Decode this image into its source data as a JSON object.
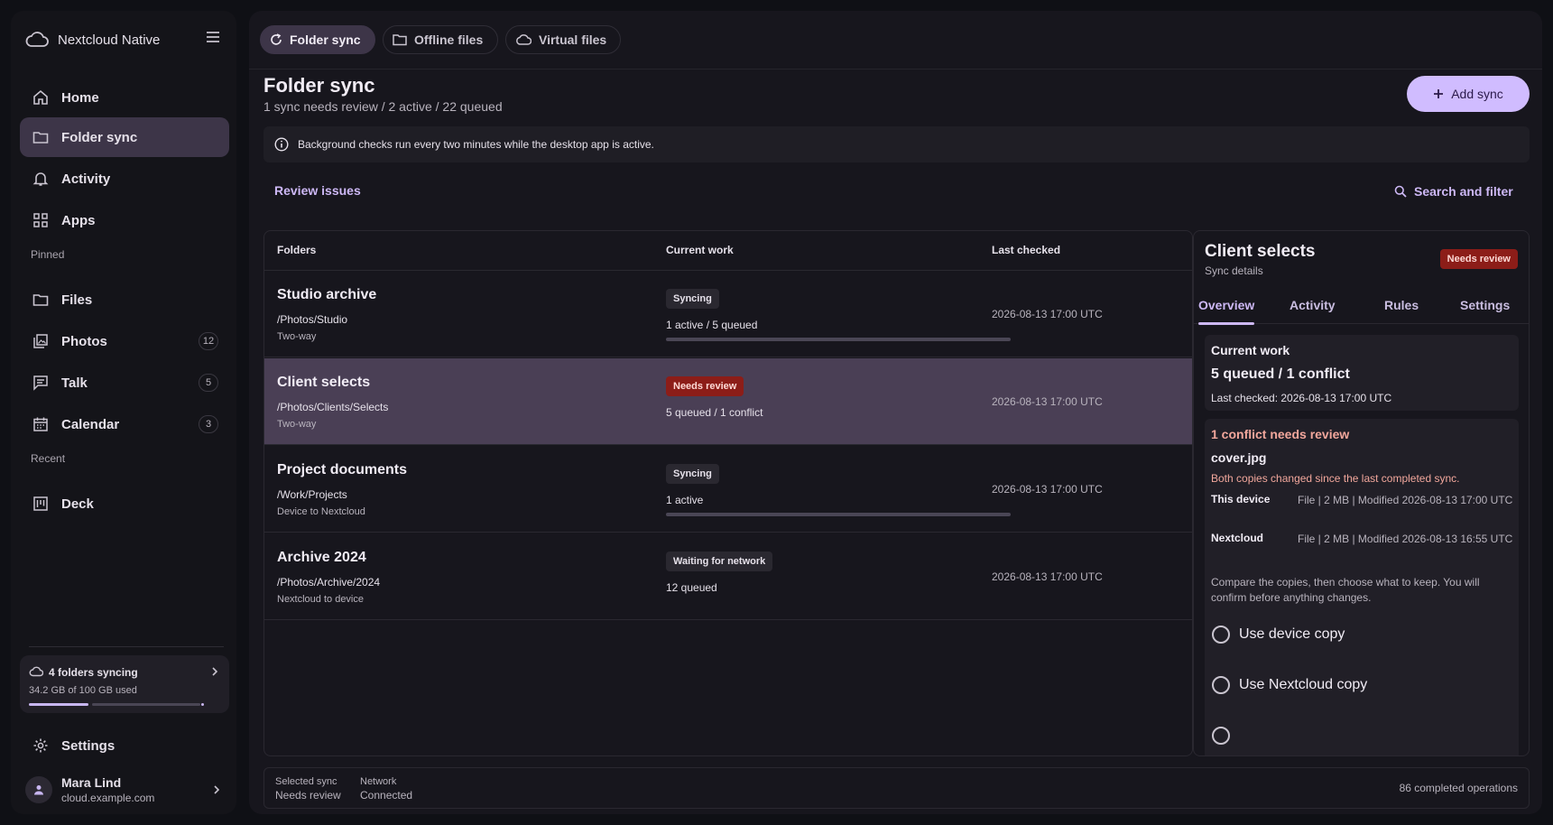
{
  "app": {
    "name": "Nextcloud Native"
  },
  "sidebar": {
    "nav": [
      {
        "label": "Home",
        "icon": "home-icon"
      },
      {
        "label": "Folder sync",
        "icon": "folder-icon",
        "active": true
      },
      {
        "label": "Activity",
        "icon": "bell-icon"
      },
      {
        "label": "Apps",
        "icon": "apps-grid-icon"
      }
    ],
    "pinned_label": "Pinned",
    "pinned": [
      {
        "label": "Files",
        "icon": "folder-icon",
        "count": ""
      },
      {
        "label": "Photos",
        "icon": "photos-icon",
        "count": "12"
      },
      {
        "label": "Talk",
        "icon": "chat-icon",
        "count": "5"
      },
      {
        "label": "Calendar",
        "icon": "calendar-icon",
        "count": "3"
      }
    ],
    "recent_label": "Recent",
    "recent": [
      {
        "label": "Deck",
        "icon": "deck-icon"
      }
    ],
    "quota": {
      "title": "4 folders syncing",
      "subtitle": "34.2 GB of 100 GB used",
      "used_fraction": 0.342
    },
    "settings_label": "Settings",
    "user": {
      "name": "Mara Lind",
      "host": "cloud.example.com"
    }
  },
  "top_tabs": [
    {
      "label": "Folder sync",
      "icon": "sync-icon",
      "active": true
    },
    {
      "label": "Offline files",
      "icon": "folder-icon"
    },
    {
      "label": "Virtual files",
      "icon": "cloud-icon"
    }
  ],
  "header": {
    "title": "Folder sync",
    "subtitle": "1 sync needs review / 2 active / 22 queued",
    "add_button": "Add sync"
  },
  "info": {
    "text": "Background checks run every two minutes while the desktop app is active."
  },
  "toolbar": {
    "review": "Review issues",
    "search": "Search and filter"
  },
  "table": {
    "columns": [
      "Folders",
      "Current work",
      "Last checked"
    ],
    "rows": [
      {
        "name": "Studio archive",
        "path": "/Photos/Studio",
        "mode": "Two-way",
        "status": "Syncing",
        "work": "1 active / 5 queued",
        "checked": "2026-08-13 17:00 UTC",
        "progress": 0.0
      },
      {
        "name": "Client selects",
        "path": "/Photos/Clients/Selects",
        "mode": "Two-way",
        "status": "Needs review",
        "work": "5 queued / 1 conflict",
        "checked": "2026-08-13 17:00 UTC"
      },
      {
        "name": "Project documents",
        "path": "/Work/Projects",
        "mode": "Device to Nextcloud",
        "status": "Syncing",
        "work": "1 active",
        "checked": "2026-08-13 17:00 UTC",
        "progress": 0.0
      },
      {
        "name": "Archive 2024",
        "path": "/Photos/Archive/2024",
        "mode": "Nextcloud to device",
        "status": "Waiting for network",
        "work": "12 queued",
        "checked": "2026-08-13 17:00 UTC"
      }
    ]
  },
  "details": {
    "title": "Client selects",
    "subtitle": "Sync details",
    "badge": "Needs review",
    "tabs": [
      "Overview",
      "Activity",
      "Rules",
      "Settings"
    ],
    "work_label": "Current work",
    "work_value": "5 queued / 1 conflict",
    "last_checked": "Last checked: 2026-08-13 17:00 UTC",
    "conflict": {
      "title": "1 conflict needs review",
      "file": "cover.jpg",
      "description": "Both copies changed since the last completed sync.",
      "device_label": "This device",
      "device_value": "File | 2 MB | Modified 2026-08-13 17:00 UTC",
      "cloud_label": "Nextcloud",
      "cloud_value": "File | 2 MB | Modified 2026-08-13 16:55 UTC",
      "help": "Compare the copies, then choose what to keep. You will confirm before anything changes.",
      "options": [
        "Use device copy",
        "Use Nextcloud copy"
      ]
    }
  },
  "footer": {
    "selected_label": "Selected sync",
    "selected_value": "Needs review",
    "network_label": "Network",
    "network_value": "Connected",
    "completed": "86 completed operations"
  }
}
